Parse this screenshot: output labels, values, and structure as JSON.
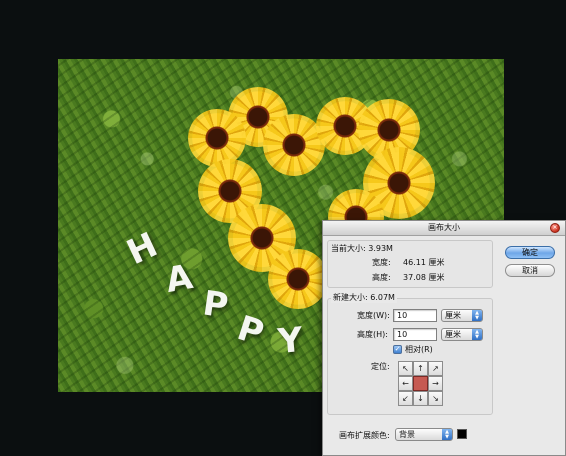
{
  "dialog": {
    "title": "画布大小",
    "current_size": {
      "label": "当前大小: 3.93M",
      "width_label": "宽度:",
      "width_value": "46.11 厘米",
      "height_label": "高度:",
      "height_value": "37.08 厘米"
    },
    "new_size": {
      "label": "新建大小: 6.07M",
      "width_label": "宽度(W):",
      "width_value": "10",
      "width_unit": "厘米",
      "height_label": "高度(H):",
      "height_value": "10",
      "height_unit": "厘米",
      "relative_label": "相对(R)",
      "relative_checked": true,
      "anchor_label": "定位:",
      "anchor_arrows": [
        "↖",
        "↑",
        "↗",
        "←",
        "",
        "→",
        "↙",
        "↓",
        "↘"
      ]
    },
    "extension_color": {
      "label": "画布扩展颜色:",
      "value": "背景",
      "swatch_color": "#000000"
    },
    "ok_label": "确定",
    "cancel_label": "取消",
    "close_icon": "close-icon"
  },
  "canvas": {
    "letters": [
      "H",
      "A",
      "P",
      "P",
      "Y"
    ],
    "accent_flower": "#f6c81a"
  }
}
